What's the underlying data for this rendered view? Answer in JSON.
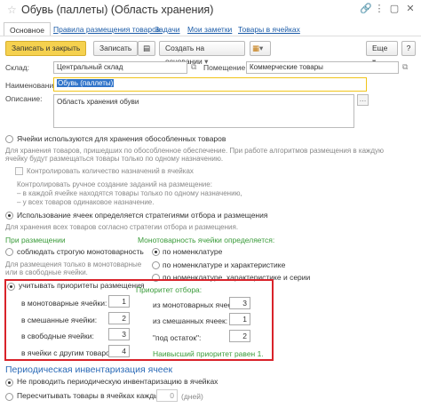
{
  "window": {
    "title": "Обувь (паллеты) (Область хранения)"
  },
  "tabs": [
    {
      "label": "Основное"
    },
    {
      "label": "Правила размещения товаров"
    },
    {
      "label": "Задачи"
    },
    {
      "label": "Мои заметки"
    },
    {
      "label": "Товары в ячейках"
    }
  ],
  "toolbar": {
    "save_close": "Записать и закрыть",
    "save": "Записать",
    "create_basis": "Создать на основании",
    "more": "Еще",
    "help": "?"
  },
  "fields": {
    "warehouse_label": "Склад:",
    "warehouse_value": "Центральный склад",
    "room_label": "Помещение:",
    "room_value": "Коммерческие товары",
    "name_label": "Наименование:",
    "name_value": "Обувь (паллеты)",
    "desc_label": "Описание:",
    "desc_value": "Область хранения обуви"
  },
  "separate_goods": {
    "radio_label": "Ячейки используются для хранения обособленных товаров",
    "note1": "Для хранения товаров, пришедших по обособленное обеспечение. При работе алгоритмов размещения в каждую",
    "note2": "ячейку будут размещаться товары только по одному назначению.",
    "control_label": "Контролировать количество назначений в ячейках",
    "manual_note1": "Контролировать ручное создание заданий на размещение:",
    "manual_note2": "– в каждой ячейке находятся товары только по одному назначению,",
    "manual_note3": "– у всех товаров одинаковое назначение."
  },
  "strategies": {
    "radio_label": "Использование ячеек определяется стратегиями отбора и размещения",
    "note": "Для хранения всех товаров согласно стратегии отбора и размещения.",
    "placement_header": "При размещении",
    "strict_mono": "соблюдать строгую монотоварность",
    "strict_note1": "Для размещения только в монотоварные",
    "strict_note2": "или в свободные ячейки.",
    "priorities_label": "учитывать приоритеты размещения",
    "mono_header": "Монотоварность ячейки определяется:",
    "by_nomenclature": "по номенклатуре",
    "by_nom_char": "по номенклатуре и характеристике",
    "by_nom_char_series": "по номенклатуре, характеристике и серии"
  },
  "priorities": {
    "mono_label": "в монотоварные ячейки:",
    "mono_value": "1",
    "mixed_label": "в смешанные ячейки:",
    "mixed_value": "2",
    "free_label": "в свободные ячейки:",
    "free_value": "3",
    "other_label": "в ячейки с другим товаром:",
    "other_value": "4"
  },
  "pick_priority": {
    "header": "Приоритет отбора:",
    "mono_label": "из монотоварных ячеек:",
    "mono_value": "3",
    "mixed_label": "из смешанных ячеек:",
    "mixed_value": "1",
    "under_label": "\"под остаток\":",
    "under_value": "2",
    "highest_note": "Наивысший приоритет равен 1."
  },
  "inventory": {
    "header": "Периодическая инвентаризация ячеек",
    "no_periodic": "Не проводить периодическую инвентаризацию в ячейках",
    "recount_label": "Пересчитывать товары в ячейках каждые:",
    "recount_value": "0",
    "days_label": "(дней)"
  }
}
